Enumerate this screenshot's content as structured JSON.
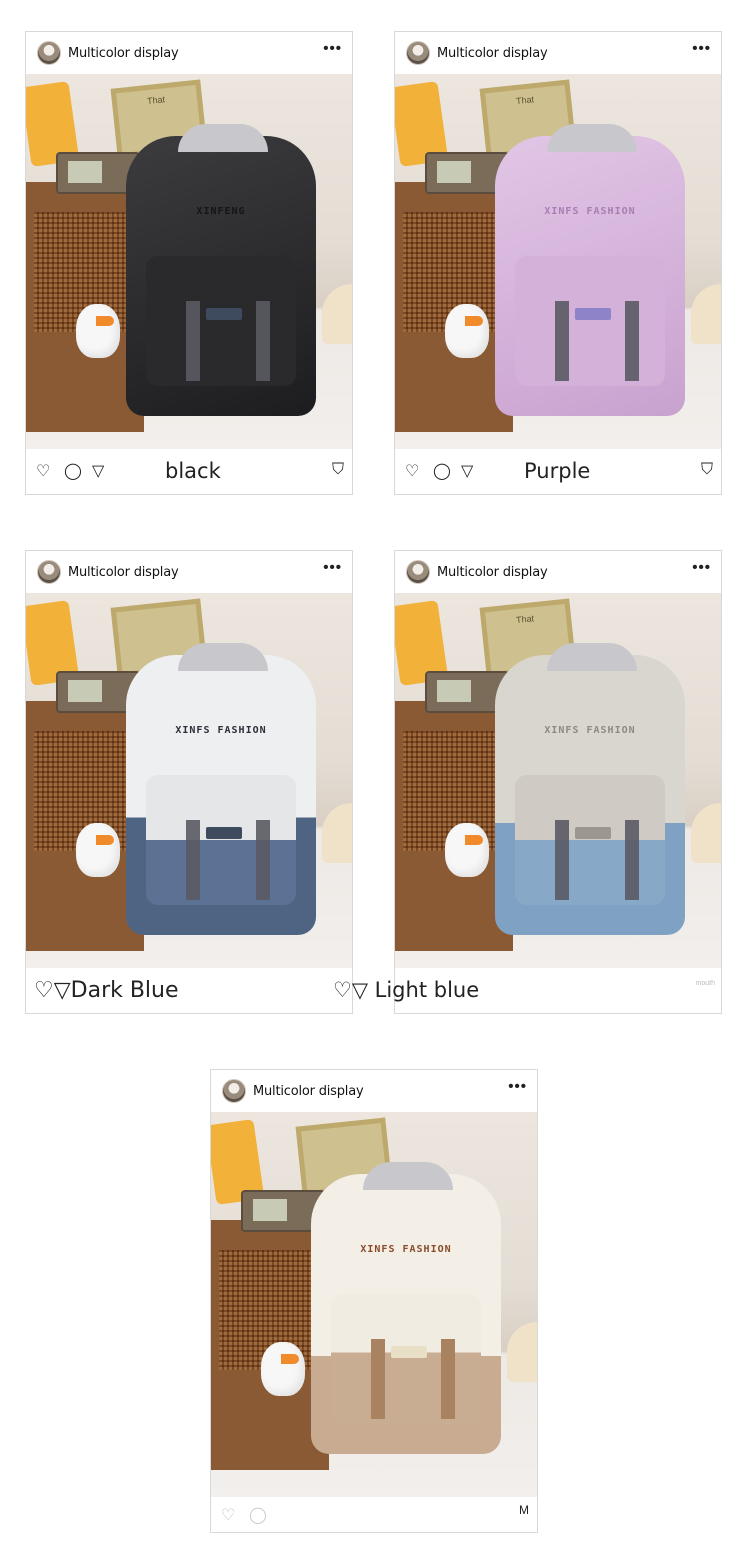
{
  "posts": [
    {
      "username": "Multicolor display",
      "caption": "black",
      "variant": "black",
      "footer_icons": [
        "heart-icon",
        "comment-icon",
        "share-icon",
        "bookmark-icon"
      ]
    },
    {
      "username": "Multicolor display",
      "caption": "Purple",
      "variant": "purple",
      "footer_icons": [
        "heart-icon",
        "comment-icon",
        "share-icon",
        "bookmark-icon"
      ]
    },
    {
      "username": "Multicolor display",
      "caption": "♡▽Dark Blue",
      "variant": "dark-blue"
    },
    {
      "username": "Multicolor display",
      "caption": "♡▽ Light blue",
      "variant": "light-blue",
      "small_text": "mouth"
    },
    {
      "username": "Multicolor display",
      "caption": "",
      "variant": "cream",
      "small_text": "M"
    }
  ],
  "photo_labels": {
    "frame_text": "That",
    "brand_black": "XINFENG",
    "brand_purple": "XINFS FASHION",
    "brand_darkblue": "XINFS FASHION",
    "brand_lightblue": "XINFS FASHION",
    "brand_cream": "XINFS FASHION"
  },
  "icons": {
    "more": "more-horizontal-icon",
    "heart": "♡",
    "comment": "◯",
    "share": "▽",
    "bookmark": "⛉"
  },
  "colors": {
    "border": "#d8d8d8",
    "text": "#222222",
    "background": "#ffffff"
  }
}
